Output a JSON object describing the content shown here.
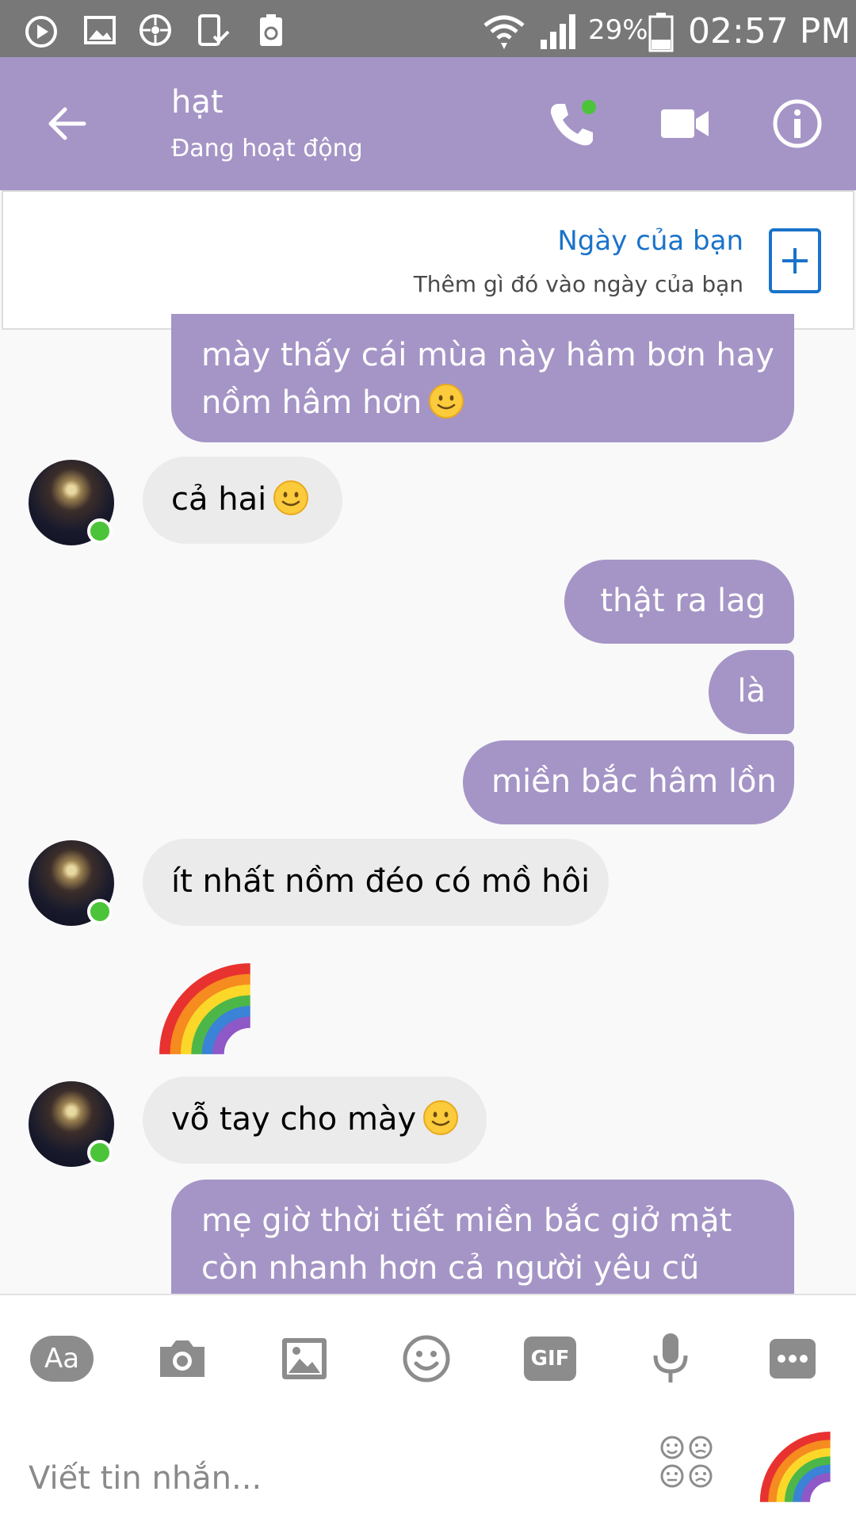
{
  "status_bar": {
    "battery_percent": "29%",
    "time": "02:57 PM",
    "left_icons": [
      "media-play-icon",
      "image-notification-icon",
      "settings-wheel-icon",
      "phone-check-icon",
      "recycle-battery-icon"
    ],
    "right_icons": [
      "wifi-icon",
      "cellular-signal-icon",
      "battery-icon"
    ]
  },
  "header": {
    "contact_name": "hạt",
    "contact_status": "Đang hoạt động",
    "colors": {
      "background": "#a595c6",
      "online": "#4cc439"
    }
  },
  "day_banner": {
    "title": "Ngày của bạn",
    "subtitle": "Thêm gì đó vào ngày của bạn",
    "accent_color": "#1a73c9"
  },
  "messages": [
    {
      "direction": "out",
      "text_lines": [
        "mày thấy cái mùa này hâm bơn hay",
        "nồm hâm hơn"
      ],
      "emoji": "slightly-smiling-emoji"
    },
    {
      "direction": "in",
      "text": "cả hai",
      "emoji": "slightly-smiling-emoji"
    },
    {
      "direction": "out",
      "text": "thật ra lag"
    },
    {
      "direction": "out",
      "text": "là"
    },
    {
      "direction": "out",
      "text": "miền bắc hâm lồn"
    },
    {
      "direction": "in",
      "text": "ít nhất nồm đéo có mồ hôi"
    },
    {
      "direction": "in",
      "sticker": "rainbow-emoji"
    },
    {
      "direction": "in",
      "text": "vỗ tay cho mày",
      "emoji": "slightly-smiling-emoji"
    },
    {
      "direction": "out",
      "text_lines": [
        "mẹ giờ thời tiết miền bắc giở mặt",
        "còn nhanh hơn cả người yêu cũ"
      ]
    }
  ],
  "composer": {
    "aa_label": "Aa",
    "gif_label": "GIF",
    "placeholder": "Viết tin nhắn...",
    "tools": [
      "text-format-button",
      "camera-icon",
      "gallery-icon",
      "emoji-icon",
      "gif-button",
      "microphone-icon",
      "more-icon"
    ],
    "quick_reaction": "rainbow-emoji"
  }
}
